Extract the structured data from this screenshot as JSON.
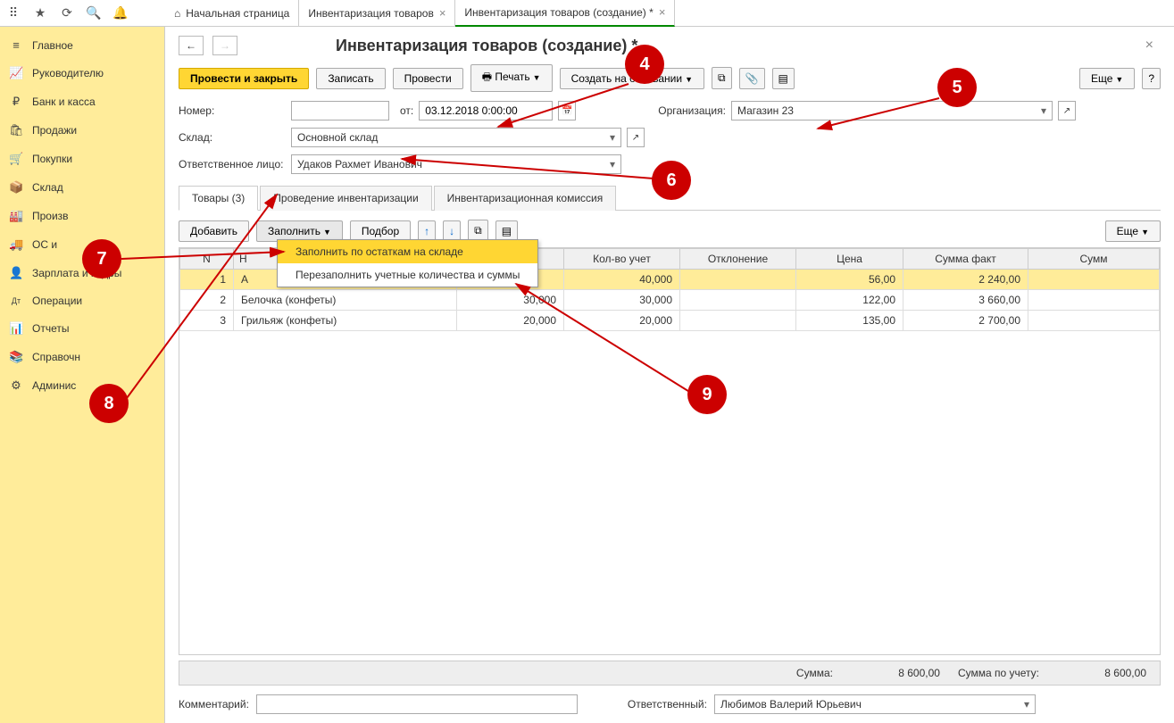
{
  "topbar_icons": [
    "apps-icon",
    "star-icon",
    "history-icon",
    "search-icon",
    "bell-icon"
  ],
  "tabs": [
    {
      "label": "Начальная страница",
      "home": true
    },
    {
      "label": "Инвентаризация товаров",
      "closable": true
    },
    {
      "label": "Инвентаризация товаров (создание) *",
      "closable": true,
      "active": true
    }
  ],
  "sidebar": [
    {
      "icon": "≡",
      "label": "Главное"
    },
    {
      "icon": "📈",
      "label": "Руководителю"
    },
    {
      "icon": "₽",
      "label": "Банк и касса"
    },
    {
      "icon": "🛍",
      "label": "Продажи"
    },
    {
      "icon": "🛒",
      "label": "Покупки"
    },
    {
      "icon": "📦",
      "label": "Склад"
    },
    {
      "icon": "🏭",
      "label": "Произв"
    },
    {
      "icon": "🚚",
      "label": "ОС и"
    },
    {
      "icon": "👤",
      "label": "Зарплата и кадры"
    },
    {
      "icon": "Дт",
      "label": "Операции"
    },
    {
      "icon": "📊",
      "label": "Отчеты"
    },
    {
      "icon": "📚",
      "label": "Справочн"
    },
    {
      "icon": "⚙",
      "label": "Админис"
    }
  ],
  "page_title": "Инвентаризация товаров (создание) *",
  "toolbar": {
    "post_close": "Провести и закрыть",
    "save": "Записать",
    "post": "Провести",
    "print": "Печать",
    "create_from": "Создать на основании",
    "more": "Еще"
  },
  "form": {
    "number_label": "Номер:",
    "number": "",
    "from_label": "от:",
    "date": "03.12.2018 0:00:00",
    "org_label": "Организация:",
    "org": "Магазин 23",
    "warehouse_label": "Склад:",
    "warehouse": "Основной склад",
    "responsible_label": "Ответственное лицо:",
    "responsible": "Удаков Рахмет Иванович"
  },
  "inner_tabs": [
    "Товары (3)",
    "Проведение инвентаризации",
    "Инвентаризационная комиссия"
  ],
  "subtoolbar": {
    "add": "Добавить",
    "fill": "Заполнить",
    "pick": "Подбор",
    "more": "Еще"
  },
  "fill_menu": [
    "Заполнить по остаткам на складе",
    "Перезаполнить учетные количества и суммы"
  ],
  "columns": [
    "N",
    "Н",
    "",
    "Кол-во учет",
    "Отклонение",
    "Цена",
    "Сумма факт",
    "Сумм"
  ],
  "rows": [
    {
      "n": "1",
      "name": "А",
      "qty": "",
      "acct": "40,000",
      "dev": "",
      "price": "56,00",
      "fact": "2 240,00",
      "sum": ""
    },
    {
      "n": "2",
      "name": "Белочка (конфеты)",
      "qty": "30,000",
      "acct": "30,000",
      "dev": "",
      "price": "122,00",
      "fact": "3 660,00",
      "sum": ""
    },
    {
      "n": "3",
      "name": "Грильяж (конфеты)",
      "qty": "20,000",
      "acct": "20,000",
      "dev": "",
      "price": "135,00",
      "fact": "2 700,00",
      "sum": ""
    }
  ],
  "totals": {
    "sum_label": "Сумма:",
    "sum": "8 600,00",
    "acct_label": "Сумма по учету:",
    "acct": "8 600,00"
  },
  "bottom": {
    "comment_label": "Комментарий:",
    "comment": "",
    "resp_label": "Ответственный:",
    "resp": "Любимов Валерий Юрьевич"
  },
  "callouts": {
    "4": "4",
    "5": "5",
    "6": "6",
    "7": "7",
    "8": "8",
    "9": "9"
  }
}
